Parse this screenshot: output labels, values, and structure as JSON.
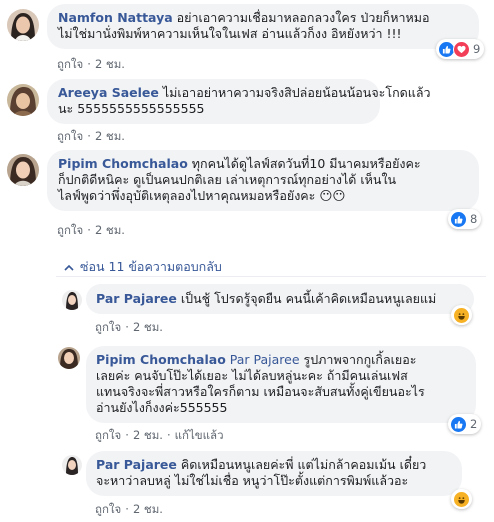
{
  "comments": [
    {
      "author": "Namfon Nattaya",
      "lines": [
        "อย่าเอาความเชื่อมาหลอกลวงใคร ป่วยก็หาหมอ",
        "ไม่ใช่มานั่งพิมพ์หาความเห็นใจในเฟส อ่านแล้วก็งง อิหยังหว่า !!!"
      ],
      "like": "ถูกใจ",
      "time": "2 ชม.",
      "reaction_count": "9",
      "reaction_icons": [
        "like-icon",
        "love-icon"
      ]
    },
    {
      "author": "Areeya Saelee",
      "lines": [
        "ไม่เอาอย่าหาความจริงสิปล่อยน้อนน้อนจะโกดแล้ว",
        "นะ 5555555555555555"
      ],
      "like": "ถูกใจ",
      "time": "2 ชม."
    },
    {
      "author": "Pipim Chomchalao",
      "lines": [
        "ทุกคนได้ดูไลฟ์สดวันที่10 มีนาคมหรือยังคะ",
        "ก็ปกติดีหนิคะ ดูเป็นคนปกติเลย เล่าเหตุการณ์ทุกอย่างได้ เห็นใน",
        "ไลฟ์พูดว่าพึ่งอุบัติเหตุลองไปหาคุณหมอหรือยังคะ 😶😶"
      ],
      "like": "ถูกใจ",
      "time": "2 ชม.",
      "reaction_count": "8",
      "reaction_icons": [
        "like-icon"
      ]
    }
  ],
  "hide_replies": "ซ่อน 11 ข้อความตอบกลับ",
  "replies": [
    {
      "author": "Par Pajaree",
      "lines": [
        "เป็นชู้ โปรดรู้จุดยืน คนนี้เค้าคิดเหมือนหนูเลยแม่"
      ],
      "like": "ถูกใจ",
      "time": "2 ชม.",
      "reaction_icons": [
        "haha-icon"
      ]
    },
    {
      "author": "Pipim Chomchalao",
      "mention": "Par Pajaree",
      "lines": [
        "รูปภาพจากกูเกิ้ลเยอะ",
        "เลยค่ะ คนจับโป๊ะได้เยอะ ไม่ได้ลบหลู่นะคะ ถ้ามีคนเล่นเฟส",
        "แทนจริงจะพี่สาวหรือใครก็ตาม เหมือนจะสับสนทั้งคู่เขียนอะไร",
        "อ่านยังไงก็งงค่ะ555555"
      ],
      "like": "ถูกใจ",
      "time": "2 ชม.",
      "edited": "แก้ไขแล้ว",
      "reaction_count": "2",
      "reaction_icons": [
        "like-icon"
      ]
    },
    {
      "author": "Par Pajaree",
      "lines": [
        "คิดเหมือนหนูเลยค่ะพี่ แต่ไม่กล้าคอมเม้น เดี๋ยว",
        "จะหาว่าลบหลู่ ไม่ใช่ไม่เชื่อ หนูว่าโป๊ะตั้งแต่การพิมพ์แล้วอะ"
      ],
      "like": "ถูกใจ",
      "time": "2 ชม.",
      "reaction_icons": [
        "haha-icon"
      ]
    }
  ],
  "colors": {
    "link": "#385898",
    "bubble": "#f2f3f5",
    "like": "#1877f2",
    "love": "#f33e58",
    "haha": "#f7b125"
  }
}
